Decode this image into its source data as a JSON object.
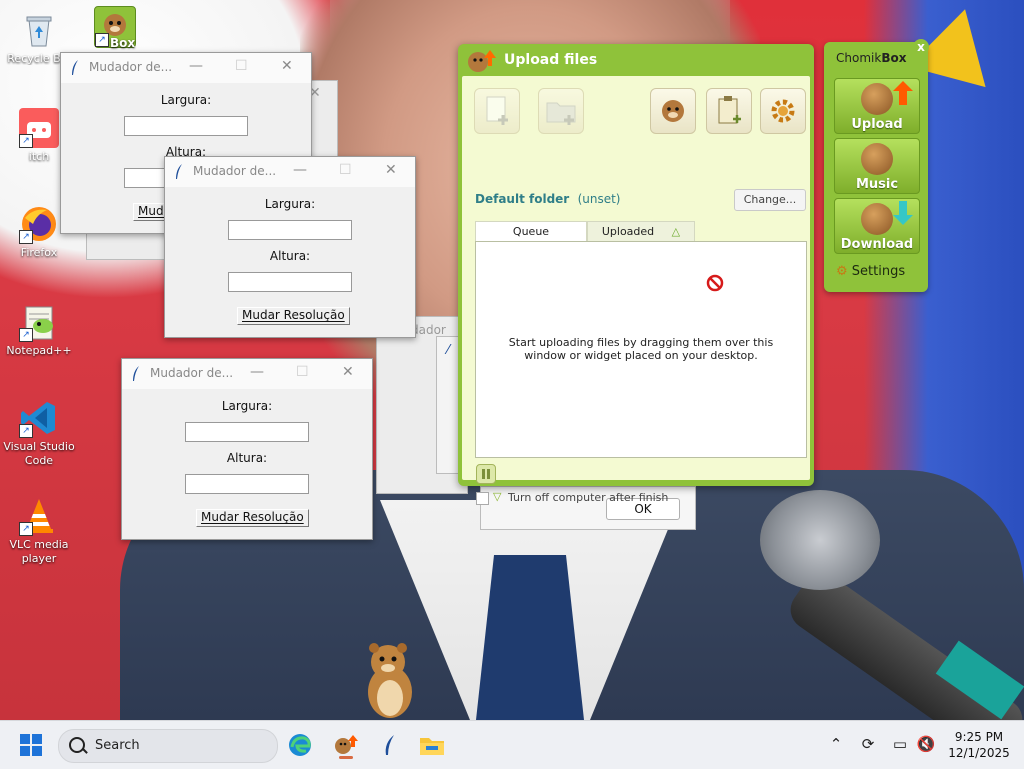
{
  "desktop": {
    "icons": [
      {
        "label": "Recycle Bin",
        "icon": "recycle-bin-icon"
      },
      {
        "label": "Box",
        "icon": "chomikbox-icon"
      },
      {
        "label": "itch",
        "icon": "itch-icon"
      },
      {
        "label": "Firefox",
        "icon": "firefox-icon"
      },
      {
        "label": "Notepad++",
        "icon": "notepad-plus-plus-icon"
      },
      {
        "label": "Visual Studio Code",
        "icon": "vscode-icon"
      },
      {
        "label": "VLC media player",
        "icon": "vlc-icon"
      }
    ]
  },
  "tk_window": {
    "title": "Mudador de...",
    "width_label": "Largura:",
    "height_label": "Altura:",
    "button_label": "Mudar Resolução",
    "minimize": "—",
    "maximize": "☐",
    "close": "✕"
  },
  "partial_window": {
    "title_fragment": "dador"
  },
  "upload": {
    "title": "Upload files",
    "default_folder_label": "Default folder",
    "default_folder_value": "(unset)",
    "change_button": "Change...",
    "tabs": [
      "Queue",
      "Uploaded"
    ],
    "empty_message": "Start uploading files by dragging them over this window or widget placed on your desktop.",
    "turn_off_label": "Turn off computer after finish",
    "ok_button": "OK"
  },
  "widget": {
    "title_prefix": "Chomik",
    "title_bold": "Box",
    "close": "x",
    "buttons": [
      "Upload",
      "Music",
      "Download"
    ],
    "settings": "Settings"
  },
  "taskbar": {
    "search_placeholder": "Search",
    "time": "9:25 PM",
    "date": "12/1/2025"
  },
  "colors": {
    "chomik_green": "#8fc23a",
    "chomik_panel": "#f4fad2",
    "folder_text": "#2f7e88"
  }
}
